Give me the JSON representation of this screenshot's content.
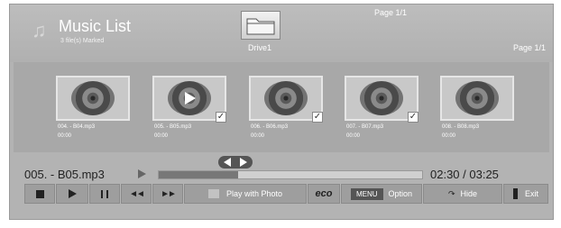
{
  "header": {
    "title": "Music List",
    "subtitle": "3 file(s) Marked",
    "drive_label": "Drive1",
    "page_top": "Page 1/1",
    "page_right": "Page 1/1"
  },
  "thumbnails": [
    {
      "name": "004. - B04.mp3",
      "time": "00:00",
      "marked": false,
      "playing": false
    },
    {
      "name": "005. - B05.mp3",
      "time": "00:00",
      "marked": true,
      "playing": true
    },
    {
      "name": "006. - B06.mp3",
      "time": "00:00",
      "marked": true,
      "playing": false
    },
    {
      "name": "007. - B07.mp3",
      "time": "00:00",
      "marked": true,
      "playing": false
    },
    {
      "name": "008. - B08.mp3",
      "time": "00:00",
      "marked": false,
      "playing": false
    }
  ],
  "player": {
    "now_file": "005. - B05.mp3",
    "time": "02:30 / 03:25",
    "progress_fraction": 0.3
  },
  "controls": {
    "play_with_photo": "Play with Photo",
    "menu_chip": "MENU",
    "option": "Option",
    "hide": "Hide",
    "exit": "Exit",
    "check_glyph": "✓",
    "rewind_glyph": "◄◄",
    "forward_glyph": "►►",
    "eco_glyph": "eco",
    "hide_glyph": "↷"
  }
}
